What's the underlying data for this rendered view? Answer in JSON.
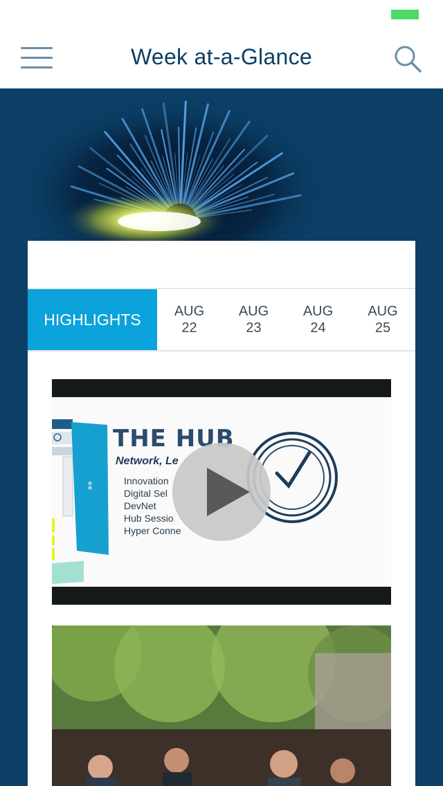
{
  "nav": {
    "title": "Week at-a-Glance",
    "menu_icon": "hamburger-menu-icon",
    "search_icon": "search-icon"
  },
  "tabs": [
    {
      "label": "HIGHLIGHTS",
      "active": true
    },
    {
      "month": "AUG",
      "day": "22"
    },
    {
      "month": "AUG",
      "day": "23"
    },
    {
      "month": "AUG",
      "day": "24"
    },
    {
      "month": "AUG",
      "day": "25"
    }
  ],
  "video": {
    "heading": "THE HUB",
    "subheading": "Network, Le",
    "items": [
      "Innovation",
      "Digital Sel",
      "DevNet",
      "Hub Sessio",
      "Hyper Conne"
    ],
    "play_icon": "play-icon"
  },
  "colors": {
    "brand_dark": "#0b3f66",
    "accent": "#0ca2db",
    "battery": "#4cd964"
  }
}
